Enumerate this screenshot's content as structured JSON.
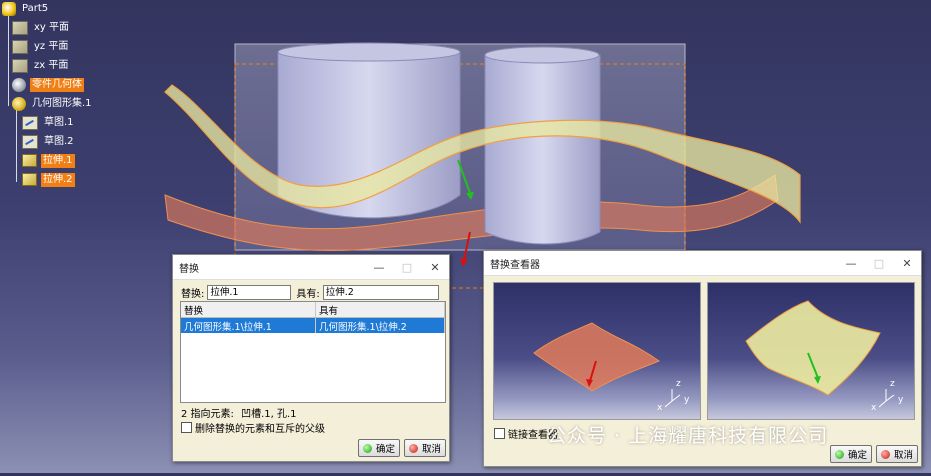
{
  "tree": {
    "root": "Part5",
    "xy": "xy 平面",
    "yz": "yz 平面",
    "zx": "zx 平面",
    "body": "零件几何体",
    "geoset": "几何图形集.1",
    "sketch1": "草图.1",
    "sketch2": "草图.2",
    "extrude1": "拉伸.1",
    "extrude2": "拉伸.2"
  },
  "replace_dialog": {
    "title": "替换",
    "replace_label": "替换:",
    "replace_value": "拉伸.1",
    "with_label": "具有:",
    "with_value": "拉伸.2",
    "table_headers": [
      "替换",
      "具有"
    ],
    "rows": [
      [
        "几何图形集.1\\拉伸.1",
        "几何图形集.1\\拉伸.2"
      ]
    ],
    "pointing_label": "2 指向元素:",
    "pointing_values": "凹槽.1, 孔.1",
    "checkbox_label": "删除替换的元素和互斥的父级",
    "ok_label": "确定",
    "cancel_label": "取消"
  },
  "viewer_dialog": {
    "title": "替换查看器",
    "link_label": "链接查看器",
    "ok_label": "确定",
    "cancel_label": "取消",
    "axis_x": "x",
    "axis_y": "y",
    "axis_z": "z"
  },
  "watermark": "公众号 · 上海耀唐科技有限公司",
  "colors": {
    "highlight": "#f07f15",
    "selection": "#1f7ad6",
    "surface_red": "#e07a5a",
    "surface_yellow": "#e9e8a0",
    "green_arrow": "#22c01e",
    "red_arrow": "#d81010"
  }
}
